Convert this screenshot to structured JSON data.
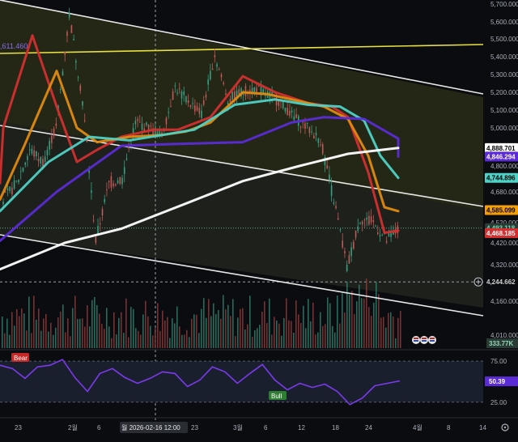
{
  "chart_data": {
    "type": "line",
    "main_pane": {
      "y_ticks": [
        4010,
        4160,
        4320,
        4420,
        4520,
        4680,
        4800,
        4900,
        5000,
        5100,
        5200,
        5300,
        5400,
        5500,
        5600,
        5700
      ],
      "y_tick_labels": [
        "4,010.000",
        "4,160.000",
        "4,320.000",
        "4,420.000",
        "4,520.000",
        "4,680.000",
        "4,800.000",
        "4,900.000",
        "5,000.000",
        "5,100.000",
        "5,200.000",
        "5,300.000",
        "5,400.000",
        "5,500.000",
        "5,600.000",
        "5,700.000"
      ],
      "price_tags": [
        {
          "label": "4,888.701",
          "value": 4888.701,
          "bg": "#ffffff",
          "fg": "#000000"
        },
        {
          "label": "4,846.294",
          "value": 4846.294,
          "bg": "#5b2bd6",
          "fg": "#ffffff"
        },
        {
          "label": "4,744.896",
          "value": 4744.896,
          "bg": "#4fd1c5",
          "fg": "#000000"
        },
        {
          "label": "4,585.099",
          "value": 4585.099,
          "bg": "#f59e0b",
          "fg": "#000000"
        },
        {
          "label": "4,493.118",
          "value": 4493.118,
          "bg": "#2a3b36",
          "fg": "#7fd6b0"
        },
        {
          "label": "4,468.185",
          "value": 4468.185,
          "bg": "#d32f2f",
          "fg": "#ffffff"
        },
        {
          "label": "4,244.662",
          "value": 4244.662,
          "bg": "#0b0c0f",
          "fg": "#d0d0d0"
        }
      ],
      "volume_tag": {
        "label": "333.77K",
        "bg": "#2a3b36",
        "fg": "#8fd8b5"
      },
      "top_left_label": ",611.460",
      "series": [
        {
          "name": "",
          "color": "#d32f2f",
          "values": [
            4720,
            5000,
            5520,
            5120,
            4820,
            4880,
            4950,
            4990,
            4990,
            5060,
            5290,
            5200,
            5140,
            5120,
            5060,
            4770,
            4470,
            4480
          ]
        },
        {
          "name": "",
          "color": "#e08a10",
          "values": [
            4640,
            4900,
            5320,
            5000,
            4920,
            4950,
            4960,
            4980,
            5030,
            5200,
            5190,
            5150,
            5120,
            5050,
            4850,
            4600,
            4580
          ]
        },
        {
          "name": "",
          "color": "#4fd1c5",
          "values": [
            4580,
            4820,
            4950,
            4930,
            4960,
            4990,
            5130,
            5160,
            5130,
            5120,
            5040,
            4850,
            4745
          ]
        },
        {
          "name": "",
          "color": "#5b2bd6",
          "values": [
            4430,
            4680,
            4900,
            4910,
            4920,
            5030,
            5060,
            5050,
            4940,
            4846
          ]
        },
        {
          "name": "",
          "color": "#ffffff",
          "values": [
            4300,
            4420,
            4490,
            4620,
            4730,
            4800,
            4860,
            4889
          ]
        }
      ],
      "price_line": [
        4640,
        4720,
        4880,
        4820,
        5000,
        5640,
        5150,
        4430,
        4720,
        4740,
        5030,
        5000,
        4960,
        5230,
        5150,
        5080,
        5410,
        5160,
        5200,
        5220,
        5190,
        5140,
        5060,
        5000,
        4930,
        4640,
        4300,
        4540,
        4520,
        4430,
        4493
      ]
    },
    "oscillator": {
      "y_ticks": [
        25,
        50.39,
        75
      ],
      "y_tick_labels": [
        "25.00",
        "50.39",
        "75.00"
      ],
      "values": [
        70,
        66,
        54,
        68,
        70,
        77,
        55,
        38,
        60,
        66,
        55,
        48,
        54,
        62,
        60,
        44,
        52,
        68,
        62,
        48,
        60,
        71,
        52,
        40,
        48,
        43,
        47,
        38,
        22,
        30,
        45,
        48,
        51
      ],
      "tags": [
        {
          "label": "Bear",
          "bg": "#c62828"
        },
        {
          "label": "Bull",
          "bg": "#2e7d32"
        }
      ]
    },
    "x_tick_labels": [
      "23",
      "2월",
      "6",
      "9",
      "월 2026-02-16  12:00",
      "23",
      "3월",
      "6",
      "12",
      "18",
      "24",
      "4월",
      "8",
      "14"
    ]
  }
}
